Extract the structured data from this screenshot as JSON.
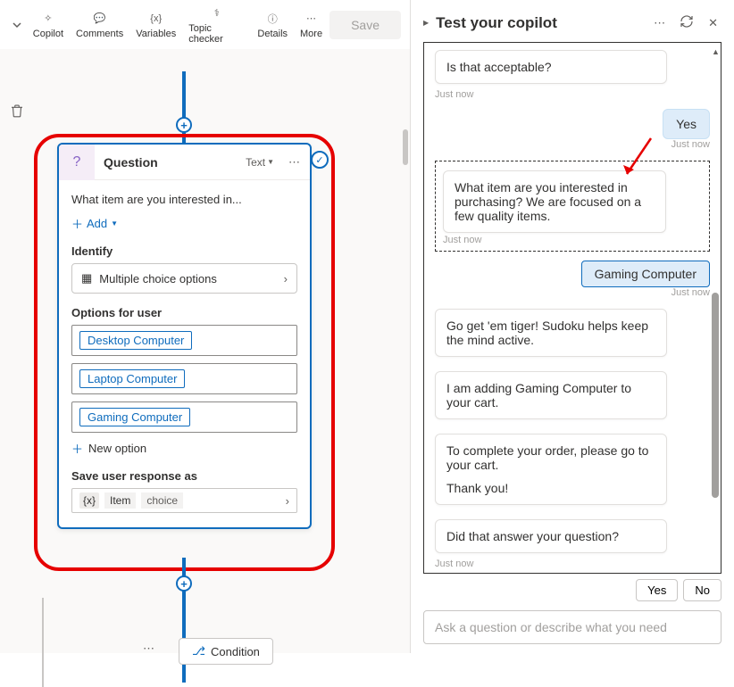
{
  "toolbar": {
    "items": [
      "Copilot",
      "Comments",
      "Variables",
      "Topic checker",
      "Details",
      "More"
    ],
    "save": "Save"
  },
  "card": {
    "title": "Question",
    "text_label": "Text",
    "prompt": "What item are you interested in...",
    "add": "Add",
    "identify_label": "Identify",
    "identify_value": "Multiple choice options",
    "options_label": "Options for user",
    "options": [
      "Desktop Computer",
      "Laptop Computer",
      "Gaming Computer"
    ],
    "new_option": "New option",
    "save_as_label": "Save user response as",
    "var_badge": "{x}",
    "var_name": "Item",
    "var_type": "choice"
  },
  "condition": "Condition",
  "test": {
    "title": "Test your copilot",
    "m1": "Is that acceptable?",
    "t1": "Just now",
    "u1": "Yes",
    "t2": "Just now",
    "m2": "What item are you interested in purchasing? We are focused on a few quality items.",
    "t3": "Just now",
    "u2": "Gaming Computer",
    "t4": "Just now",
    "m3": "Go get 'em tiger! Sudoku helps keep the mind active.",
    "m4": "I am adding Gaming Computer to your cart.",
    "m5a": "To complete your order, please go to your cart.",
    "m5b": "Thank you!",
    "m6": "Did that answer your question?",
    "t5": "Just now",
    "yes": "Yes",
    "no": "No",
    "placeholder": "Ask a question or describe what you need"
  }
}
